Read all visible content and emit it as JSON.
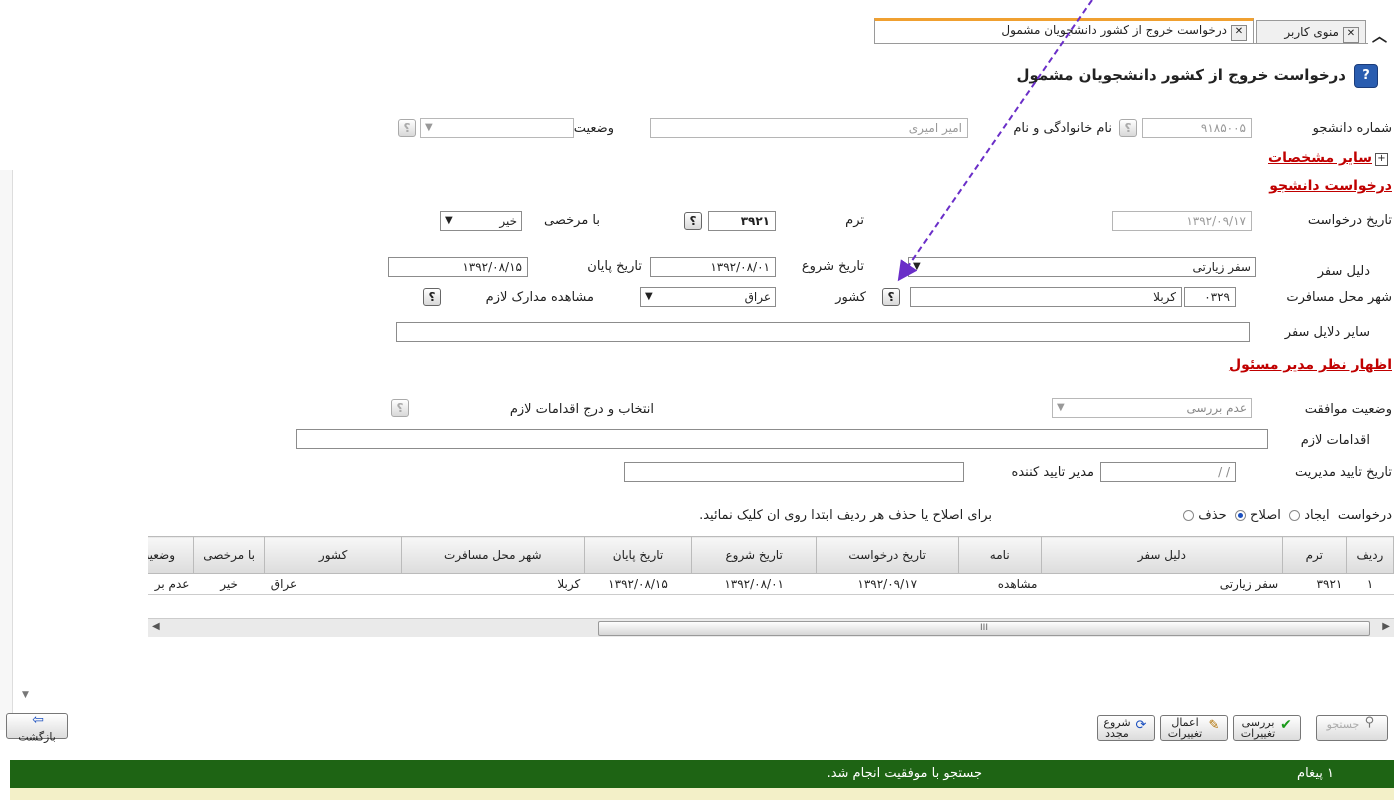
{
  "tabs": [
    {
      "label": "درخواست خروج از کشور دانشجویان مشمول",
      "active": true
    },
    {
      "label": "منوی کاربر",
      "active": false
    }
  ],
  "page_title": "درخواست خروج از کشور دانشجویان مشمول",
  "student": {
    "number_label": "شماره دانشجو",
    "number_value": "۹۱۸۵۰۰۵",
    "name_label": "نام خانوادگی و نام",
    "name_value": "امیر امیری",
    "status_label": "وضعیت"
  },
  "other_specs_label": "سایر مشخصات",
  "request_section": "درخواست دانشجو",
  "request": {
    "date_label": "تاریخ درخواست",
    "date_value": "۱۳۹۲/۰۹/۱۷",
    "term_label": "ترم",
    "term_value": "۳۹۲۱",
    "leave_label": "با مرخصی",
    "leave_value": "خیر",
    "reason_label": "دلیل سفر",
    "reason_value": "سفر زیارتی",
    "start_label": "تاریخ شروع",
    "start_value": "۱۳۹۲/۰۸/۰۱",
    "end_label": "تاریخ پایان",
    "end_value": "۱۳۹۲/۰۸/۱۵",
    "city_label": "شهر محل مسافرت",
    "city_code": "۰۳۲۹",
    "city_name": "کربلا",
    "country_label": "کشور",
    "country_value": "عراق",
    "docs_label": "مشاهده مدارک لازم",
    "other_reasons_label": "سایر دلایل سفر"
  },
  "manager_section": "اظهار نظر مدیر مسئول",
  "manager": {
    "approval_label": "وضعیت موافقت",
    "approval_value": "عدم بررسی",
    "select_actions_label": "انتخاب و درج اقدامات لازم",
    "actions_label": "اقدامات لازم",
    "approve_date_label": "تاریخ تایید مدیریت",
    "approve_date_value": "/       /",
    "approver_label": "مدیر تایید کننده"
  },
  "mode": {
    "label": "درخواست",
    "create": "ایجاد",
    "edit": "اصلاح",
    "delete": "حذف",
    "selected": "edit",
    "hint": "برای اصلاح یا حذف هر ردیف ابتدا روی ان کلیک نمائید."
  },
  "table": {
    "headers": [
      "ردیف",
      "ترم",
      "دلیل سفر",
      "نامه",
      "تاریخ درخواست",
      "تاریخ شروع",
      "تاریخ پایان",
      "شهر محل مسافرت",
      "کشور",
      "با مرخصی",
      "وضعیت"
    ],
    "rows": [
      [
        "۱",
        "۳۹۲۱",
        "سفر زیارتی",
        "مشاهده",
        "۱۳۹۲/۰۹/۱۷",
        "۱۳۹۲/۰۸/۰۱",
        "۱۳۹۲/۰۸/۱۵",
        "کربلا",
        "عراق",
        "خیر",
        "عدم بر"
      ]
    ],
    "scroll_grip": "III"
  },
  "toolbar": {
    "search": "جستجو",
    "review": "بررسی تغییرات",
    "apply": "اعمال تغییرات",
    "restart": "شروع مجدد",
    "back": "بازگشت"
  },
  "status_bar": {
    "count": "۱ پیغام",
    "message": "جستجو با موفقیت انجام شد."
  },
  "colors": {
    "status_bg": "#1e6414",
    "section_red": "#c00000",
    "arrow": "#6a2ec8"
  }
}
